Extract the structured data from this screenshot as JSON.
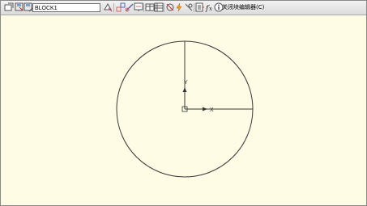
{
  "toolbar": {
    "block_name": "BLOCK1",
    "close_editor_label": "关闭块编辑器(C)",
    "icons": [
      "block-editor-open-icon",
      "save-block-icon",
      "save-block-as-icon",
      "authoring-palettes-icon",
      "parameter-icon",
      "action-icon",
      "parameter-set-icon",
      "visibility-state-icon",
      "lookup-table-icon",
      "constraint-icon",
      "auto-constrain-icon",
      "attribute-icon",
      "block-table-icon",
      "fx-parameters-manager-icon",
      "info-icon"
    ]
  },
  "canvas": {
    "background": "#fefce4",
    "ucs_x_label": "X",
    "ucs_y_label": "Y"
  }
}
